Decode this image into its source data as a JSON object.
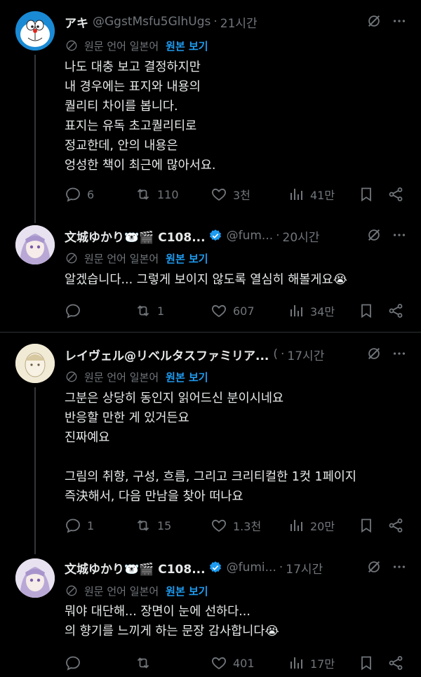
{
  "posts": [
    {
      "name": "アキ",
      "handle": "@GgstMsfu5GlhUgs",
      "time": "21시간",
      "translate_text": "원문 언어 일본어",
      "translate_link": "원본 보기",
      "body": "나도 대충 보고 결정하지만\n내 경우에는 표지와 내용의\n퀄리티 차이를 봅니다.\n표지는 유독 초고퀄리티로\n정교한데, 안의 내용은\n엉성한 책이 최근에 많아서요.",
      "replies": "6",
      "reposts": "110",
      "likes": "3천",
      "views": "41만"
    },
    {
      "name": "文城ゆかり🐻‍❄️🎬 C108...",
      "handle": "@fum...",
      "time": "20시간",
      "translate_text": "원문 언어 일본어",
      "translate_link": "원본 보기",
      "body": "알겠습니다... 그렇게 보이지 않도록 열심히 해볼게요😭",
      "replies": "",
      "reposts": "1",
      "likes": "607",
      "views": "34만"
    },
    {
      "name": "レイヴェル@リベルタスファミリア...",
      "handle": "(",
      "time": "17시간",
      "translate_text": "원문 언어 일본어",
      "translate_link": "원본 보기",
      "body": "그분은 상당히 동인지 읽어드신 분이시네요\n반응할 만한 게 있거든요\n진짜예요\n\n그림의 취향, 구성, 흐름, 그리고 크리티컬한 1컷 1페이지\n즉決해서, 다음 만남을 찾아 떠나요",
      "replies": "1",
      "reposts": "15",
      "likes": "1.3천",
      "views": "20만"
    },
    {
      "name": "文城ゆかり🐻‍❄️🎬 C108...",
      "handle": "@fumi...",
      "time": "17시간",
      "translate_text": "원문 언어 일본어",
      "translate_link": "원본 보기",
      "body": "뭐야 대단해... 장면이 눈에 선하다...\n의 향기를 느끼게 하는 문장 감사합니다😭",
      "replies": "",
      "reposts": "",
      "likes": "401",
      "views": "17만"
    }
  ],
  "colors": {
    "background": "#000000",
    "text": "#e7e9ea",
    "muted": "#71767b",
    "link": "#1d9bf0"
  }
}
